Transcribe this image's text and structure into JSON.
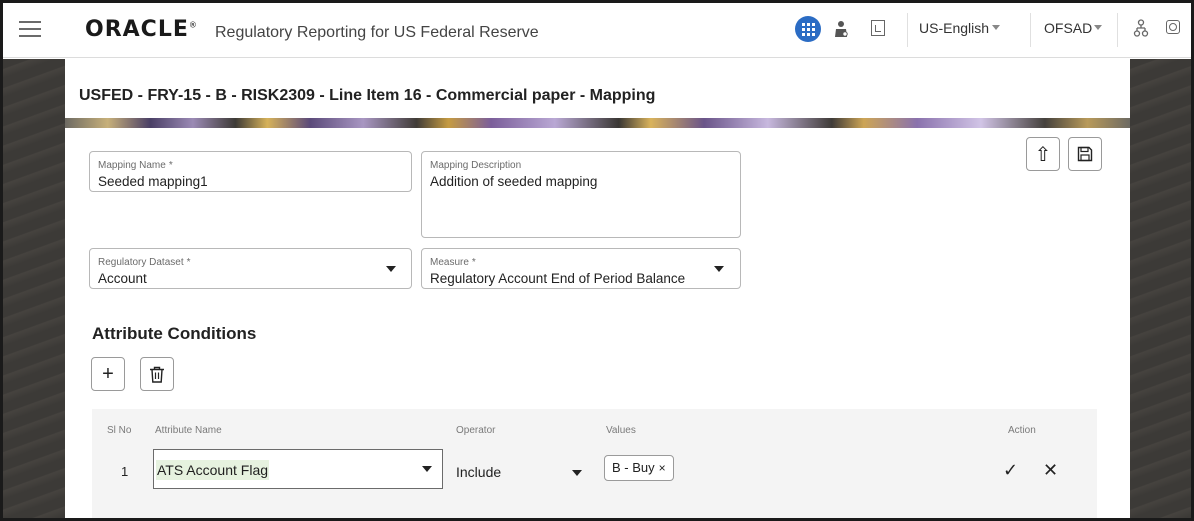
{
  "header": {
    "logo": "ORACLE",
    "logo_mark": "®",
    "app_title": "Regulatory Reporting for US Federal Reserve",
    "language": "US-English",
    "user": "OFSAD",
    "icons": [
      "menu-icon",
      "apps-grid-icon",
      "person-icon",
      "document-icon",
      "sitemap-icon",
      "settings-icon"
    ]
  },
  "page": {
    "title": "USFED - FRY-15 - B - RISK2309 - Line Item 16 - Commercial paper - Mapping"
  },
  "form": {
    "mapping_name_label": "Mapping Name",
    "mapping_name_value": "Seeded mapping1",
    "mapping_description_label": "Mapping Description",
    "mapping_description_value": "Addition of seeded mapping",
    "regulatory_dataset_label": "Regulatory Dataset",
    "regulatory_dataset_value": "Account",
    "measure_label": "Measure",
    "measure_value": "Regulatory Account End of Period Balance",
    "required_marker": "*"
  },
  "toolbar": {
    "upload_icon": "⇧",
    "save_icon": "💾",
    "add_icon": "+",
    "delete_icon": "🗑"
  },
  "attributes": {
    "section_title": "Attribute Conditions",
    "columns": {
      "sl_no": "Sl No",
      "attribute_name": "Attribute Name",
      "operator": "Operator",
      "values": "Values",
      "action": "Action"
    },
    "rows": [
      {
        "sl_no": "1",
        "attribute_name": "ATS Account Flag",
        "operator": "Include",
        "value_chip": "B - Buy",
        "chip_remove": "×",
        "accept": "✓",
        "cancel": "✕"
      }
    ]
  },
  "colors": {
    "accent_blue": "#2b6cc4",
    "side_panel": "#3c3a37",
    "highlight": "#e6f2df"
  }
}
